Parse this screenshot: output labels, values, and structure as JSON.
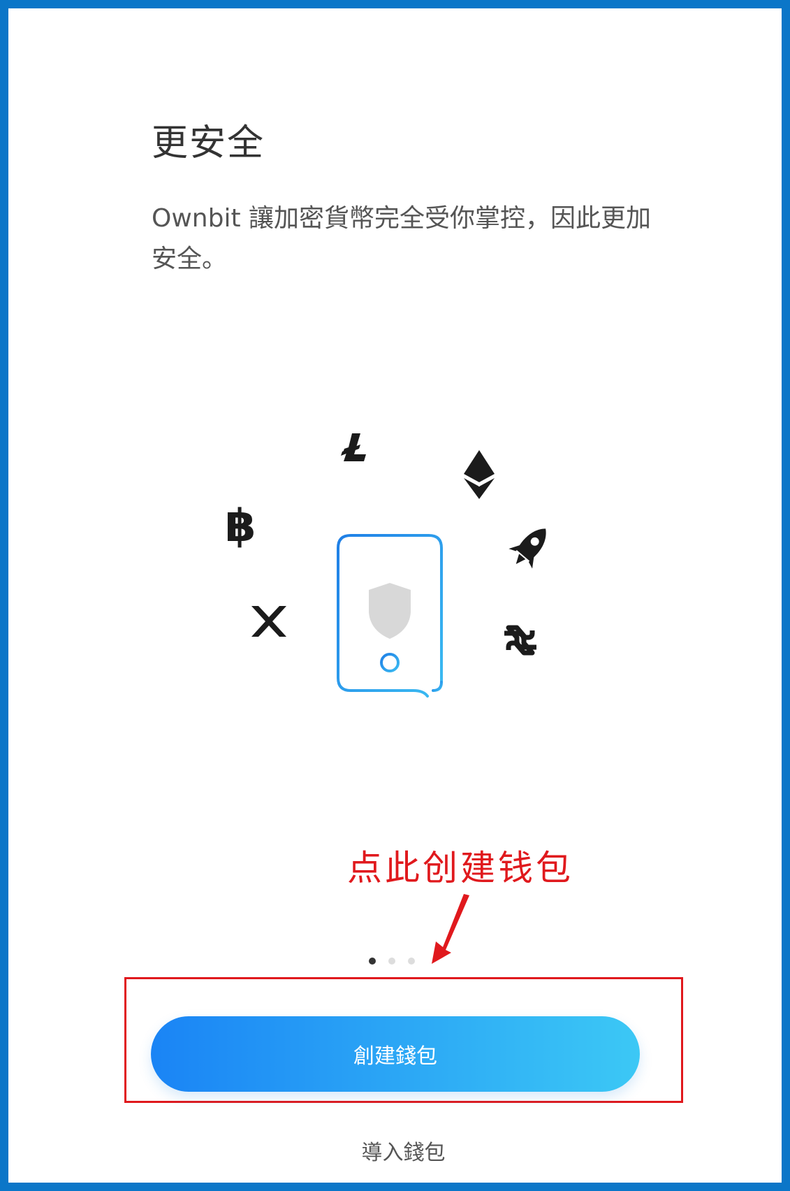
{
  "onboarding": {
    "title": "更安全",
    "description": "Ownbit 讓加密貨幣完全受你掌控，因此更加安全。",
    "page_indicator": {
      "total": 3,
      "current": 1
    }
  },
  "illustration": {
    "icons": [
      "litecoin-icon",
      "ethereum-icon",
      "bitcoin-icon",
      "stellar-rocket-icon",
      "xrp-icon",
      "decred-icon",
      "phone-shield-icon"
    ],
    "colors": {
      "phone_outline": "#2a8ee8",
      "shield": "#d8d8d8",
      "coin_icons": "#1b1b1b"
    }
  },
  "annotation": {
    "text": "点此创建钱包",
    "color": "#e0191d"
  },
  "actions": {
    "create_wallet_label": "創建錢包",
    "import_wallet_label": "導入錢包"
  },
  "colors": {
    "frame_border": "#0b76c8",
    "button_gradient_start": "#1a84f5",
    "button_gradient_end": "#3cc8f5",
    "highlight_box": "#e0191d"
  }
}
